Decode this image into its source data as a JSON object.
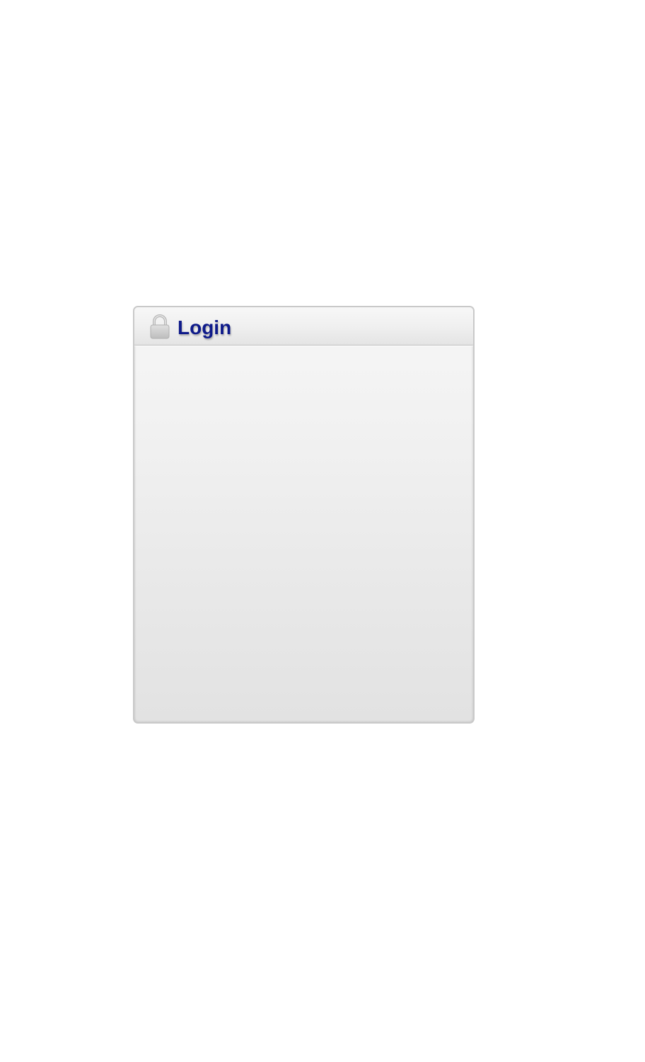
{
  "login": {
    "title": "Login",
    "icon": "lock-icon"
  },
  "colors": {
    "title": "#0e1a8a",
    "panel_border": "#c9c9c9",
    "panel_top": "#f6f6f6",
    "panel_bottom": "#e2e2e2",
    "lock_body": "#cfcfcf"
  }
}
